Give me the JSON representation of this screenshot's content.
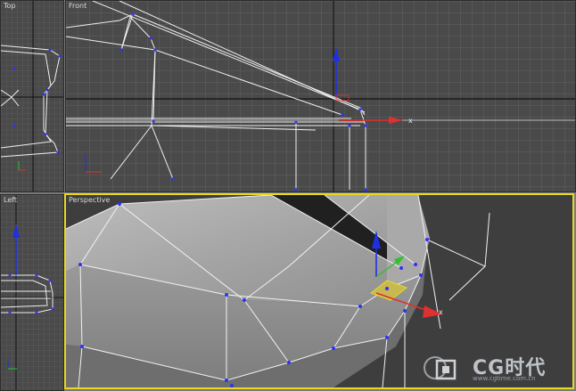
{
  "viewports": {
    "top": {
      "label": "Top"
    },
    "front": {
      "label": "Front"
    },
    "left": {
      "label": "Left"
    },
    "perspective": {
      "label": "Perspective",
      "active": true,
      "border_color": "#e8d820"
    }
  },
  "gizmo": {
    "x_axis_label": "x",
    "x_color": "#e03030",
    "y_color": "#30c030",
    "z_color": "#2030e0"
  },
  "watermark": {
    "text": "CG时代",
    "url": "www.cgtime.com.cn"
  }
}
